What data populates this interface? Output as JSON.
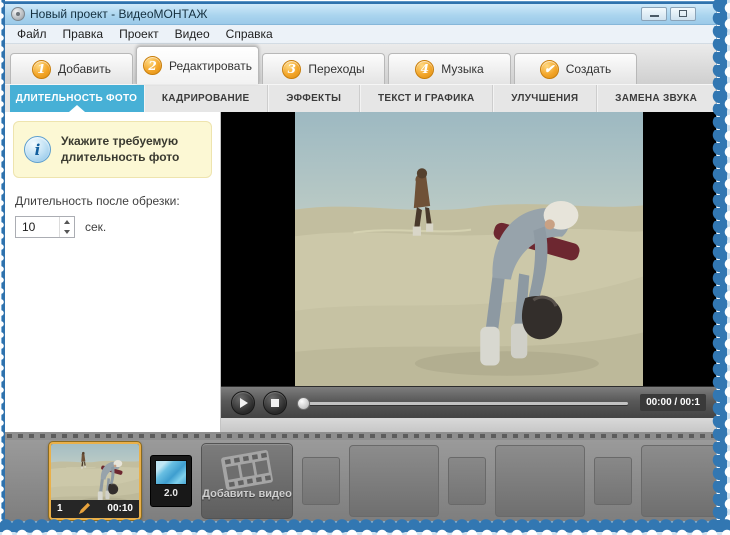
{
  "window": {
    "title": "Новый проект - ВидеоМОНТАЖ"
  },
  "menu": {
    "items": [
      "Файл",
      "Правка",
      "Проект",
      "Видео",
      "Справка"
    ]
  },
  "main_tabs": [
    {
      "badge": "1",
      "label": "Добавить",
      "active": false
    },
    {
      "badge": "2",
      "label": "Редактировать",
      "active": true
    },
    {
      "badge": "3",
      "label": "Переходы",
      "active": false
    },
    {
      "badge": "4",
      "label": "Музыка",
      "active": false
    },
    {
      "badge": "✔",
      "label": "Создать",
      "active": false
    }
  ],
  "sub_tabs": [
    {
      "label": "ДЛИТЕЛЬНОСТЬ ФОТО",
      "active": true
    },
    {
      "label": "КАДРИРОВАНИЕ",
      "active": false
    },
    {
      "label": "ЭФФЕКТЫ",
      "active": false
    },
    {
      "label": "ТЕКСТ И ГРАФИКА",
      "active": false
    },
    {
      "label": "УЛУЧШЕНИЯ",
      "active": false
    },
    {
      "label": "ЗАМЕНА ЗВУКА",
      "active": false
    }
  ],
  "duration_panel": {
    "info_text": "Укажите требуемую длительность фото",
    "field_label": "Длительность после обрезки:",
    "value": "10",
    "unit": "сек."
  },
  "player": {
    "time_display": "00:00 / 00:1"
  },
  "timeline": {
    "clip": {
      "index": "1",
      "duration": "00:10"
    },
    "transition": {
      "duration": "2.0"
    },
    "add_video_label": "Добавить видео"
  },
  "colors": {
    "titlebar_blue": "#a9d4ee",
    "accent_orange": "#f3a62a",
    "active_tab_blue": "#47b0d6",
    "info_box_yellow": "#fcf8d4",
    "selection_gold": "#eab049",
    "torn_edge_blue": "#3277b2"
  }
}
